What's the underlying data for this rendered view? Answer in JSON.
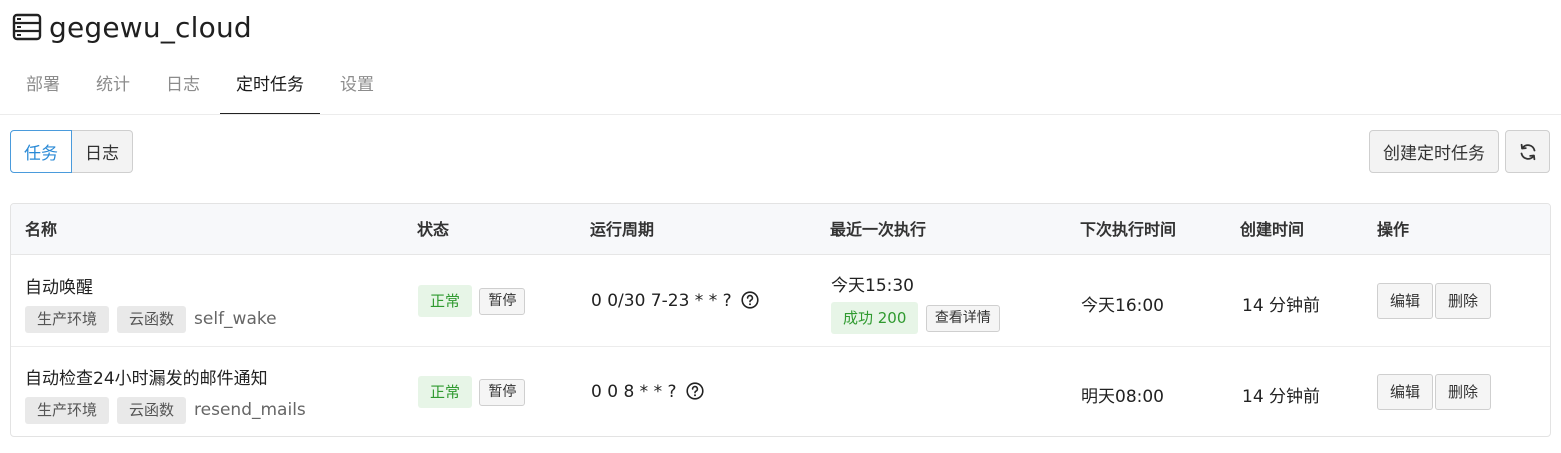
{
  "app": {
    "title": "gegewu_cloud",
    "icon": "server-icon"
  },
  "main_tabs": [
    {
      "label": "部署",
      "active": false
    },
    {
      "label": "统计",
      "active": false
    },
    {
      "label": "日志",
      "active": false
    },
    {
      "label": "定时任务",
      "active": true
    },
    {
      "label": "设置",
      "active": false
    }
  ],
  "sub_toggle": {
    "tasks_label": "任务",
    "logs_label": "日志",
    "active": "任务"
  },
  "actions": {
    "create_label": "创建定时任务",
    "refresh_icon": "refresh-icon"
  },
  "table": {
    "headers": {
      "name": "名称",
      "status": "状态",
      "cycle": "运行周期",
      "last_run": "最近一次执行",
      "next_run": "下次执行时间",
      "created": "创建时间",
      "ops": "操作"
    },
    "rows": [
      {
        "name": "自动唤醒",
        "env_tag": "生产环境",
        "type_tag": "云函数",
        "function": "self_wake",
        "status": "正常",
        "pause_label": "暂停",
        "cron": "0 0/30 7-23 * * ?",
        "last_run_time": "今天15:30",
        "last_run_result": "成功 200",
        "details_label": "查看详情",
        "next_run": "今天16:00",
        "created": "14 分钟前",
        "edit_label": "编辑",
        "delete_label": "删除"
      },
      {
        "name": "自动检查24小时漏发的邮件通知",
        "env_tag": "生产环境",
        "type_tag": "云函数",
        "function": "resend_mails",
        "status": "正常",
        "pause_label": "暂停",
        "cron": "0 0 8 * * ?",
        "next_run": "明天08:00",
        "created": "14 分钟前",
        "edit_label": "编辑",
        "delete_label": "删除"
      }
    ]
  },
  "colors": {
    "accent": "#2a8ad6",
    "success_bg": "#e7f5e7",
    "success_text": "#2f9a2f",
    "header_bg": "#f7f8fa"
  }
}
